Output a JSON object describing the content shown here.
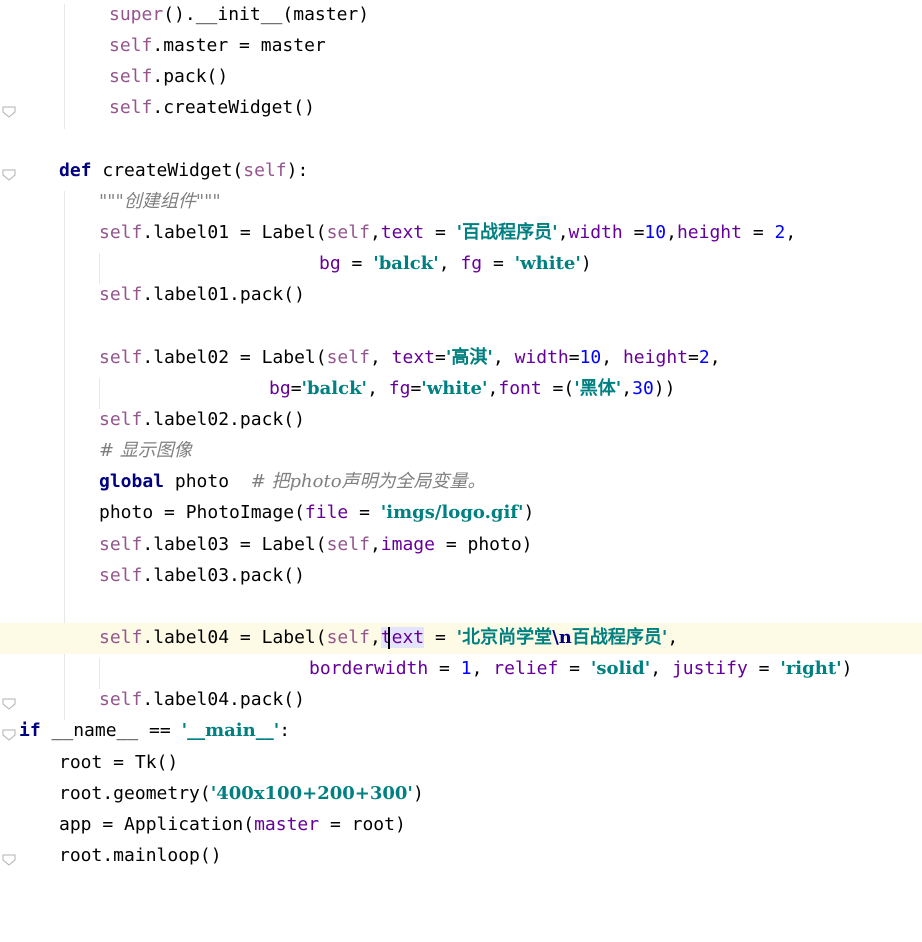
{
  "editor": {
    "language": "python",
    "current_line_index": 20,
    "lines": [
      {
        "tokens": [
          {
            "t": "super",
            "c": "builtin"
          },
          {
            "t": "().__init__(master)",
            "c": ""
          }
        ]
      },
      {
        "tokens": [
          {
            "t": "self",
            "c": "self"
          },
          {
            "t": ".master = master",
            "c": ""
          }
        ]
      },
      {
        "tokens": [
          {
            "t": "self",
            "c": "self"
          },
          {
            "t": ".pack()",
            "c": ""
          }
        ]
      },
      {
        "tokens": [
          {
            "t": "self",
            "c": "self"
          },
          {
            "t": ".createWidget()",
            "c": ""
          }
        ]
      },
      {
        "tokens": []
      },
      {
        "tokens": [
          {
            "t": "def ",
            "c": "kw"
          },
          {
            "t": "createWidget(",
            "c": ""
          },
          {
            "t": "self",
            "c": "self"
          },
          {
            "t": "):",
            "c": ""
          }
        ]
      },
      {
        "tokens": [
          {
            "t": "\"\"\"创建组件\"\"\"",
            "c": "doc"
          }
        ]
      },
      {
        "tokens": [
          {
            "t": "self",
            "c": "self"
          },
          {
            "t": ".label01 = Label(",
            "c": ""
          },
          {
            "t": "self",
            "c": "self"
          },
          {
            "t": ",",
            "c": ""
          },
          {
            "t": "text",
            "c": "param"
          },
          {
            "t": " = ",
            "c": ""
          },
          {
            "t": "'百战程序员'",
            "c": "str"
          },
          {
            "t": ",",
            "c": ""
          },
          {
            "t": "width",
            "c": "param"
          },
          {
            "t": " =",
            "c": ""
          },
          {
            "t": "10",
            "c": "num"
          },
          {
            "t": ",",
            "c": ""
          },
          {
            "t": "height",
            "c": "param"
          },
          {
            "t": " = ",
            "c": ""
          },
          {
            "t": "2",
            "c": "num"
          },
          {
            "t": ",",
            "c": ""
          }
        ]
      },
      {
        "tokens": [
          {
            "t": "bg",
            "c": "param"
          },
          {
            "t": " = ",
            "c": ""
          },
          {
            "t": "'balck'",
            "c": "str"
          },
          {
            "t": ", ",
            "c": ""
          },
          {
            "t": "fg",
            "c": "param"
          },
          {
            "t": " = ",
            "c": ""
          },
          {
            "t": "'white'",
            "c": "str"
          },
          {
            "t": ")",
            "c": ""
          }
        ]
      },
      {
        "tokens": [
          {
            "t": "self",
            "c": "self"
          },
          {
            "t": ".label01.pack()",
            "c": ""
          }
        ]
      },
      {
        "tokens": []
      },
      {
        "tokens": [
          {
            "t": "self",
            "c": "self"
          },
          {
            "t": ".label02 = Label(",
            "c": ""
          },
          {
            "t": "self",
            "c": "self"
          },
          {
            "t": ", ",
            "c": ""
          },
          {
            "t": "text",
            "c": "param"
          },
          {
            "t": "=",
            "c": ""
          },
          {
            "t": "'高淇'",
            "c": "str"
          },
          {
            "t": ", ",
            "c": ""
          },
          {
            "t": "width",
            "c": "param"
          },
          {
            "t": "=",
            "c": ""
          },
          {
            "t": "10",
            "c": "num"
          },
          {
            "t": ", ",
            "c": ""
          },
          {
            "t": "height",
            "c": "param"
          },
          {
            "t": "=",
            "c": ""
          },
          {
            "t": "2",
            "c": "num"
          },
          {
            "t": ",",
            "c": ""
          }
        ]
      },
      {
        "tokens": [
          {
            "t": "bg",
            "c": "param"
          },
          {
            "t": "=",
            "c": ""
          },
          {
            "t": "'balck'",
            "c": "str"
          },
          {
            "t": ", ",
            "c": ""
          },
          {
            "t": "fg",
            "c": "param"
          },
          {
            "t": "=",
            "c": ""
          },
          {
            "t": "'white'",
            "c": "str"
          },
          {
            "t": ",",
            "c": ""
          },
          {
            "t": "font",
            "c": "param"
          },
          {
            "t": " =(",
            "c": ""
          },
          {
            "t": "'黑体'",
            "c": "str"
          },
          {
            "t": ",",
            "c": ""
          },
          {
            "t": "30",
            "c": "num"
          },
          {
            "t": "))",
            "c": ""
          }
        ]
      },
      {
        "tokens": [
          {
            "t": "self",
            "c": "self"
          },
          {
            "t": ".label02.pack()",
            "c": ""
          }
        ]
      },
      {
        "tokens": [
          {
            "t": "# 显示图像",
            "c": "comment"
          }
        ]
      },
      {
        "tokens": [
          {
            "t": "global ",
            "c": "kw"
          },
          {
            "t": "photo  ",
            "c": ""
          },
          {
            "t": "# 把photo声明为全局变量。",
            "c": "comment"
          }
        ]
      },
      {
        "tokens": [
          {
            "t": "photo = PhotoImage(",
            "c": ""
          },
          {
            "t": "file",
            "c": "param"
          },
          {
            "t": " = ",
            "c": ""
          },
          {
            "t": "'imgs/logo.gif'",
            "c": "str"
          },
          {
            "t": ")",
            "c": ""
          }
        ]
      },
      {
        "tokens": [
          {
            "t": "self",
            "c": "self"
          },
          {
            "t": ".label03 = Label(",
            "c": ""
          },
          {
            "t": "self",
            "c": "self"
          },
          {
            "t": ",",
            "c": ""
          },
          {
            "t": "image",
            "c": "param"
          },
          {
            "t": " = photo)",
            "c": ""
          }
        ]
      },
      {
        "tokens": [
          {
            "t": "self",
            "c": "self"
          },
          {
            "t": ".label03.pack()",
            "c": ""
          }
        ]
      },
      {
        "tokens": []
      },
      {
        "tokens": [
          {
            "t": "self",
            "c": "self"
          },
          {
            "t": ".label04 = Label(",
            "c": ""
          },
          {
            "t": "self",
            "c": "self"
          },
          {
            "t": ",",
            "c": ""
          },
          {
            "t": "text",
            "c": "param-hl"
          },
          {
            "t": " = ",
            "c": ""
          },
          {
            "t": "'北京尚学堂",
            "c": "str"
          },
          {
            "t": "\\n",
            "c": "esc"
          },
          {
            "t": "百战程序员'",
            "c": "str"
          },
          {
            "t": ",",
            "c": ""
          }
        ]
      },
      {
        "tokens": [
          {
            "t": "borderwidth",
            "c": "param"
          },
          {
            "t": " = ",
            "c": ""
          },
          {
            "t": "1",
            "c": "num"
          },
          {
            "t": ", ",
            "c": ""
          },
          {
            "t": "relief",
            "c": "param"
          },
          {
            "t": " = ",
            "c": ""
          },
          {
            "t": "'solid'",
            "c": "str"
          },
          {
            "t": ", ",
            "c": ""
          },
          {
            "t": "justify",
            "c": "param"
          },
          {
            "t": " = ",
            "c": ""
          },
          {
            "t": "'right'",
            "c": "str"
          },
          {
            "t": ")",
            "c": ""
          }
        ]
      },
      {
        "tokens": [
          {
            "t": "self",
            "c": "self"
          },
          {
            "t": ".label04.pack()",
            "c": ""
          }
        ]
      },
      {
        "tokens": [
          {
            "t": "if ",
            "c": "kw"
          },
          {
            "t": "__name__ == ",
            "c": ""
          },
          {
            "t": "'__main__'",
            "c": "str"
          },
          {
            "t": ":",
            "c": ""
          }
        ]
      },
      {
        "tokens": [
          {
            "t": "root = Tk()",
            "c": ""
          }
        ]
      },
      {
        "tokens": [
          {
            "t": "root.geometry(",
            "c": ""
          },
          {
            "t": "'400x100+200+300'",
            "c": "str"
          },
          {
            "t": ")",
            "c": ""
          }
        ]
      },
      {
        "tokens": [
          {
            "t": "app = Application(",
            "c": ""
          },
          {
            "t": "master",
            "c": "param"
          },
          {
            "t": " = root)",
            "c": ""
          }
        ]
      },
      {
        "tokens": [
          {
            "t": "root.mainloop()",
            "c": ""
          }
        ]
      }
    ]
  }
}
